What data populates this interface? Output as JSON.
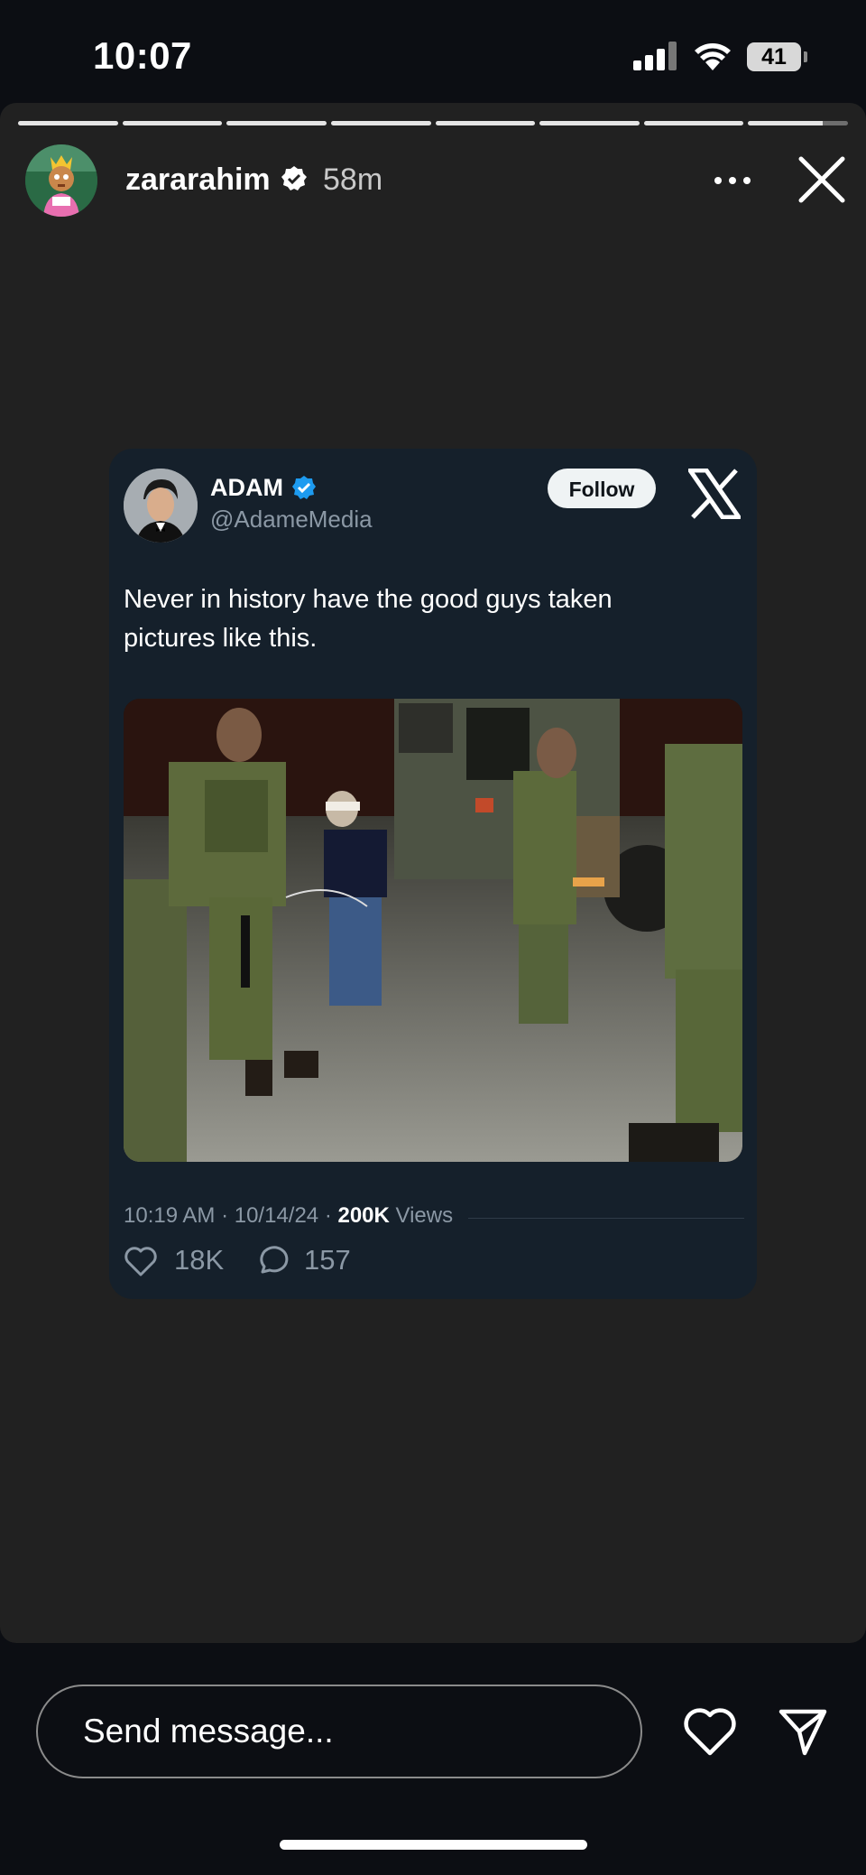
{
  "status_bar": {
    "time": "10:07",
    "battery": "41"
  },
  "story": {
    "username": "zararahim",
    "posted_ago": "58m",
    "segments_total": 8,
    "current_segment_progress": 0.75
  },
  "tweet": {
    "display_name": "ADAM",
    "handle": "@AdameMedia",
    "follow_label": "Follow",
    "text": "Never in history have the good guys taken pictures like this.",
    "timestamp": "10:19 AM · 10/14/24 · ",
    "views_count": "200K",
    "views_label": " Views",
    "likes": "18K",
    "replies": "157"
  },
  "composer": {
    "placeholder": "Send message..."
  },
  "icons": {
    "more": "more-horizontal-icon",
    "close": "close-icon",
    "verified": "verified-badge-icon",
    "x_logo": "x-logo-icon",
    "like": "heart-icon",
    "reply": "comment-icon",
    "send": "send-icon"
  },
  "colors": {
    "card_bg": "#15202b",
    "story_bg": "#212121",
    "verified_blue": "#1d9bf0",
    "secondary_text": "#8b98a5"
  }
}
